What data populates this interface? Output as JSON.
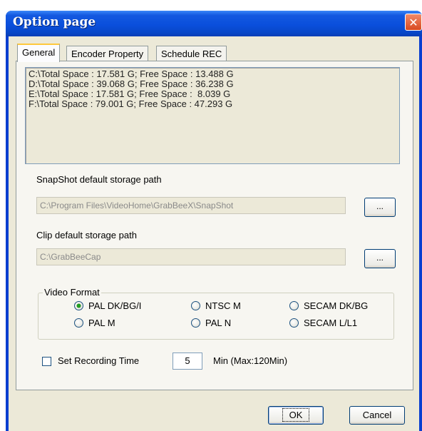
{
  "window": {
    "title": "Option page",
    "close_symbol": "✕"
  },
  "tabs": [
    {
      "label": "General",
      "active": true
    },
    {
      "label": "Encoder Property",
      "active": false
    },
    {
      "label": "Schedule REC",
      "active": false
    }
  ],
  "drives": [
    "C:\\Total Space : 17.581 G; Free Space : 13.488 G",
    "D:\\Total Space : 39.068 G; Free Space : 36.238 G",
    "E:\\Total Space : 17.581 G; Free Space :  8.039 G",
    "F:\\Total Space : 79.001 G; Free Space : 47.293 G"
  ],
  "snapshot": {
    "label": "SnapShot default storage path",
    "path": "C:\\Program Files\\VideoHome\\GrabBeeX\\SnapShot",
    "browse_label": "..."
  },
  "clip": {
    "label": "Clip default storage path",
    "path": "C:\\GrabBeeCap",
    "browse_label": "..."
  },
  "video_format": {
    "legend": "Video Format",
    "options": [
      {
        "label": "PAL DK/BG/I",
        "checked": true
      },
      {
        "label": "NTSC M",
        "checked": false
      },
      {
        "label": "SECAM DK/BG",
        "checked": false
      },
      {
        "label": "PAL M",
        "checked": false
      },
      {
        "label": "PAL N",
        "checked": false
      },
      {
        "label": "SECAM L/L1",
        "checked": false
      }
    ]
  },
  "recording": {
    "checkbox_label": "Set Recording Time",
    "checked": false,
    "value": "5",
    "unit_label": "Min (Max:120Min)"
  },
  "buttons": {
    "ok": "OK",
    "cancel": "Cancel"
  }
}
